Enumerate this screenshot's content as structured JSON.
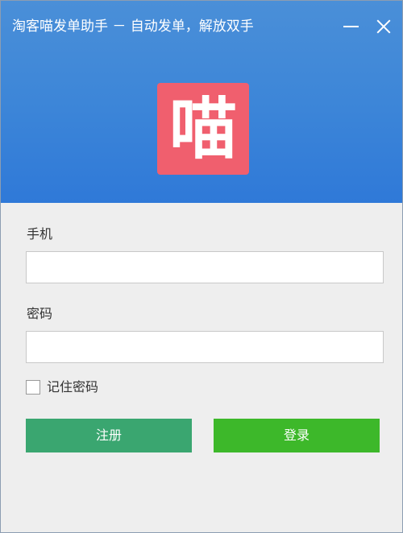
{
  "window": {
    "title": "淘客喵发单助手 － 自动发单，解放双手",
    "minimize_icon": "minimize-icon",
    "close_icon": "close-icon"
  },
  "logo": {
    "char": "喵",
    "bg_color": "#f05f6e"
  },
  "form": {
    "phone_label": "手机",
    "phone_value": "",
    "password_label": "密码",
    "password_value": "",
    "remember_label": "记住密码",
    "remember_checked": false
  },
  "buttons": {
    "register_label": "注册",
    "login_label": "登录"
  },
  "colors": {
    "header": "#3d86d8",
    "register": "#3aa670",
    "login": "#3db82a"
  }
}
